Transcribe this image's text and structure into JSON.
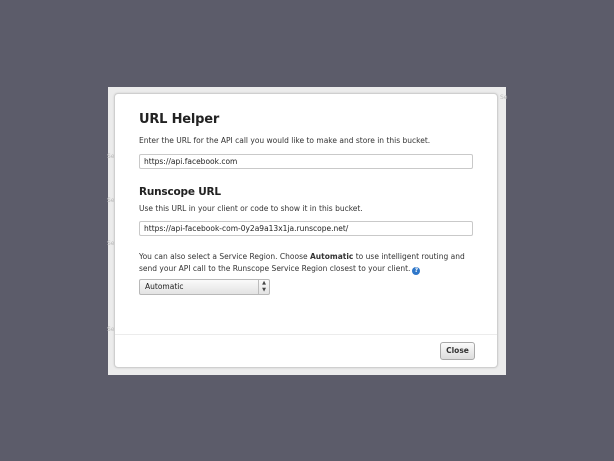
{
  "background_ghost": [
    "Se",
    "Se",
    "Se",
    "Se",
    "Se"
  ],
  "modal": {
    "title": "URL Helper",
    "intro": "Enter the URL for the API call you would like to make and store in this bucket.",
    "source_url_value": "https://api.facebook.com",
    "runscope_heading": "Runscope URL",
    "runscope_desc": "Use this URL in your client or code to show it in this bucket.",
    "runscope_url_value": "https://api-facebook-com-0y2a9a13x1ja.runscope.net/",
    "region_text_1": "You can also select a Service Region. Choose ",
    "region_text_bold": "Automatic",
    "region_text_2": " to use intelligent routing and send your API call to the Runscope Service Region closest to your client.",
    "help_glyph": "?",
    "region_select_value": "Automatic",
    "close_label": "Close"
  },
  "icons": {
    "help": "question-circle-icon",
    "select_arrows": "updown-arrows-icon"
  },
  "colors": {
    "backdrop": "#5c5c6a",
    "help_icon": "#2f77c9"
  }
}
